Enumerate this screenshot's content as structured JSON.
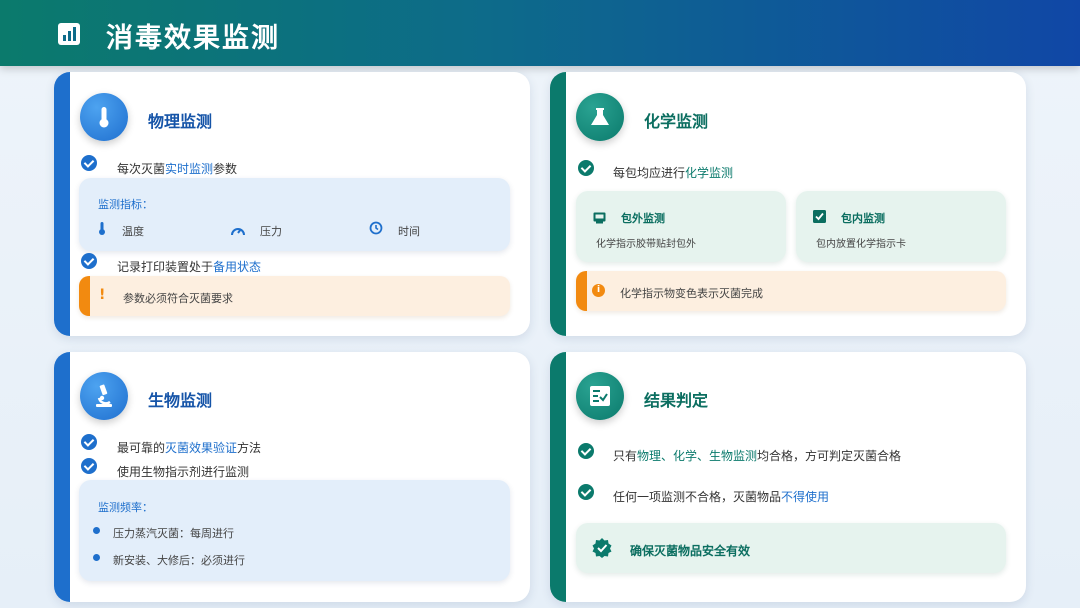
{
  "header": {
    "title": "消毒效果监测",
    "icon": "bar-chart-icon"
  },
  "physical": {
    "title": "物理监测",
    "icon": "thermometer-icon",
    "line1": {
      "pre": "每次灭菌",
      "hl": "实时监测",
      "post": "参数"
    },
    "indicators_label": "监测指标：",
    "indicators": [
      {
        "icon": "thermometer-icon",
        "label": "温度"
      },
      {
        "icon": "gauge-icon",
        "label": "压力"
      },
      {
        "icon": "clock-icon",
        "label": "时间"
      }
    ],
    "line2": {
      "pre": "记录打印装置处于",
      "hl": "备用状态"
    },
    "warning": "参数必须符合灭菌要求"
  },
  "chemical": {
    "title": "化学监测",
    "icon": "flask-icon",
    "line1": {
      "pre": "每包均应进行",
      "hl": "化学监测"
    },
    "outer": {
      "title": "包外监测",
      "desc": "化学指示胶带贴封包外",
      "icon": "tray-icon"
    },
    "inner": {
      "title": "包内监测",
      "desc": "包内放置化学指示卡",
      "icon": "checkbox-icon"
    },
    "info": "化学指示物变色表示灭菌完成"
  },
  "biological": {
    "title": "生物监测",
    "icon": "microscope-icon",
    "line1": {
      "pre": "最可靠的",
      "hl": "灭菌效果验证",
      "post": "方法"
    },
    "line2": "使用生物指示剂进行监测",
    "freq_label": "监测频率：",
    "freq": [
      "压力蒸汽灭菌：每周进行",
      "新安装、大修后：必须进行"
    ]
  },
  "result": {
    "title": "结果判定",
    "icon": "checklist-icon",
    "line1": {
      "pre": "只有",
      "hl": "物理、化学、生物监测",
      "post": "均合格，方可判定灭菌合格"
    },
    "line2": {
      "pre": "任何一项监测不合格，灭菌物品",
      "hl": "不得使用"
    },
    "conclusion": "确保灭菌物品安全有效"
  },
  "colors": {
    "blue": "#1e6fcc",
    "green": "#0b7a6c",
    "orange": "#f28a10"
  }
}
